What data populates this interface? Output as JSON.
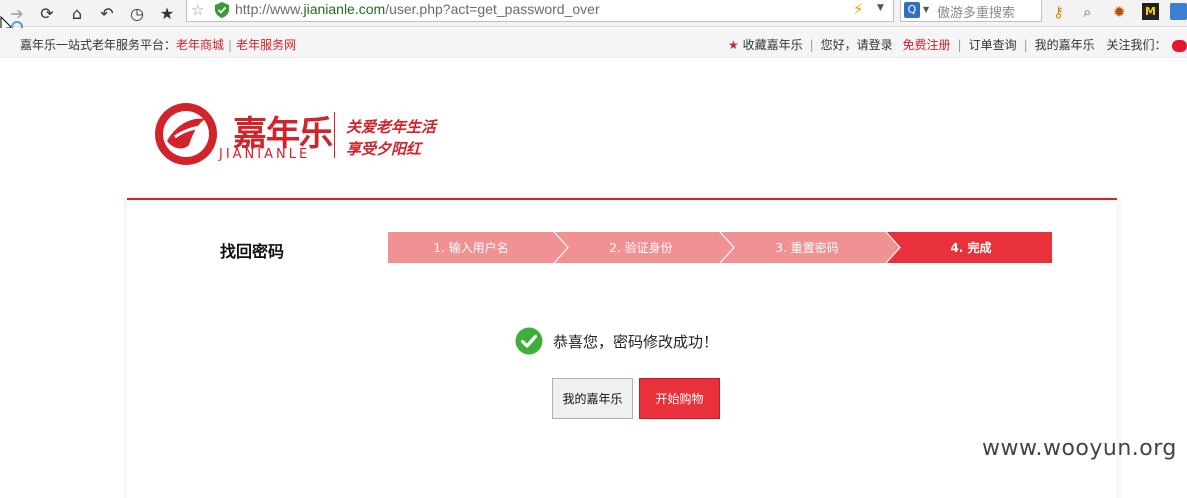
{
  "browser": {
    "url_prefix": "http://www.",
    "url_domain": "jianianle.com",
    "url_path": "/user.php?act=get_password_over",
    "search_placeholder": "傲游多重搜索"
  },
  "topnav": {
    "platform_text": "嘉年乐一站式老年服务平台：",
    "link_mall": "老年商城",
    "link_service": "老年服务网",
    "favorite": "收藏嘉年乐",
    "greeting": "您好，请登录",
    "register": "免费注册",
    "orders": "订单查询",
    "my_account": "我的嘉年乐",
    "follow": "关注我们："
  },
  "logo": {
    "name": "嘉年乐",
    "pinyin": "JIANIANLE",
    "slogan_line1": "关爱老年生活",
    "slogan_line2": "享受夕阳红"
  },
  "page": {
    "title": "找回密码",
    "steps": [
      {
        "label": "1. 输入用户名",
        "active": false
      },
      {
        "label": "2. 验证身份",
        "active": false
      },
      {
        "label": "3. 重置密码",
        "active": false
      },
      {
        "label": "4. 完成",
        "active": true
      }
    ],
    "success_message": "恭喜您，密码修改成功！",
    "button_my": "我的嘉年乐",
    "button_shop": "开始购物"
  },
  "colors": {
    "brand_red": "#d1232a",
    "step_inactive": "#f09294",
    "step_active": "#e8313a",
    "success_green": "#3fae3a"
  },
  "watermark": "www.wooyun.org"
}
